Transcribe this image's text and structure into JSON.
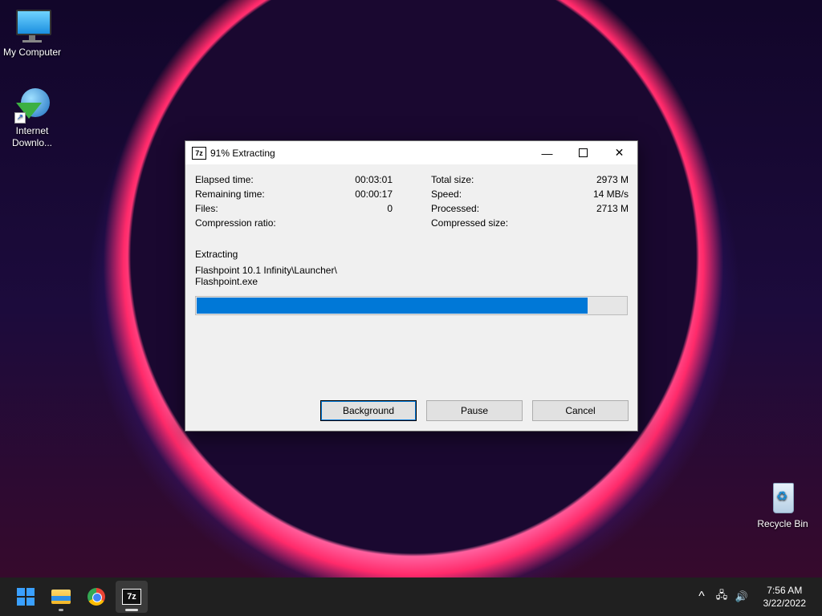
{
  "desktop": {
    "icons": [
      {
        "label": "My Computer",
        "icon": "monitor-icon"
      },
      {
        "label": "Internet Downlo...",
        "icon": "idm-icon"
      },
      {
        "label": "Recycle Bin",
        "icon": "recycle-bin-icon"
      }
    ]
  },
  "window": {
    "app_icon_text": "7z",
    "title": "91% Extracting",
    "left_stats": [
      {
        "label": "Elapsed time:",
        "value": "00:03:01"
      },
      {
        "label": "Remaining time:",
        "value": "00:00:17"
      },
      {
        "label": "Files:",
        "value": "0"
      },
      {
        "label": "Compression ratio:",
        "value": ""
      }
    ],
    "right_stats": [
      {
        "label": "Total size:",
        "value": "2973 M"
      },
      {
        "label": "Speed:",
        "value": "14 MB/s"
      },
      {
        "label": "Processed:",
        "value": "2713 M"
      },
      {
        "label": "Compressed size:",
        "value": ""
      }
    ],
    "status_label": "Extracting",
    "current_file_line1": "Flashpoint 10.1 Infinity\\Launcher\\",
    "current_file_line2": "Flashpoint.exe",
    "progress_percent": 91,
    "buttons": {
      "background": "Background",
      "pause": "Pause",
      "cancel": "Cancel"
    }
  },
  "taskbar": {
    "apps": [
      "start-icon",
      "file-explorer-icon",
      "chrome-icon",
      "7zip-icon"
    ],
    "tray": {
      "chevron": "^",
      "network": "network-icon",
      "volume": "volume-icon"
    },
    "time": "7:56 AM",
    "date": "3/22/2022"
  }
}
